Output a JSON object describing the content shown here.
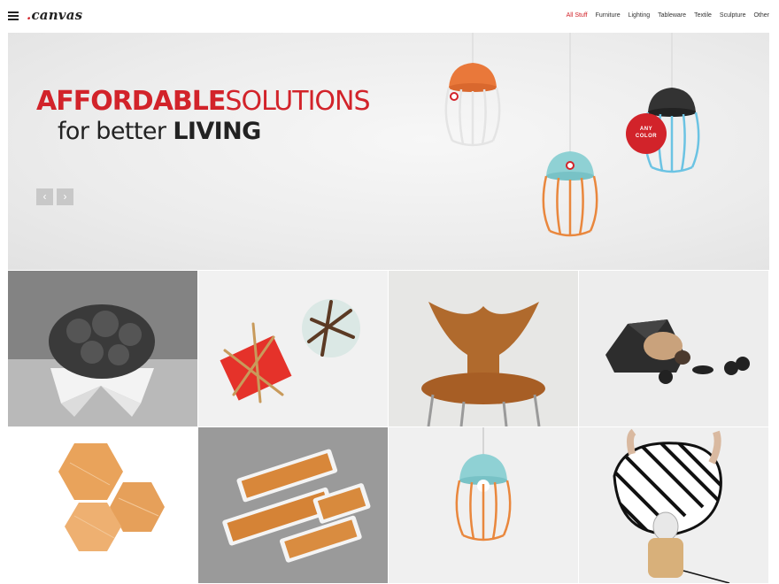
{
  "header": {
    "logo_prefix": ".",
    "logo_text": "canvas",
    "nav": [
      "All Stuff",
      "Furniture",
      "Lighting",
      "Tableware",
      "Textile",
      "Sculpture",
      "Other"
    ],
    "active_nav": "All Stuff"
  },
  "hero": {
    "headline_bold": "AFFORDABLE",
    "headline_light": "SOLUTIONS",
    "subline_light": "for better ",
    "subline_bold": "LIVING",
    "badge_line1": "ANY",
    "badge_line2": "COLOR",
    "prev_icon": "‹",
    "next_icon": "›"
  },
  "colors": {
    "accent": "#d2232a",
    "text": "#222222"
  },
  "portfolio": {
    "items": [
      "chair",
      "trivets",
      "wooden-chair",
      "dog-bed",
      "hexagon-tiles",
      "trays",
      "lamp",
      "striped-lamp"
    ]
  }
}
